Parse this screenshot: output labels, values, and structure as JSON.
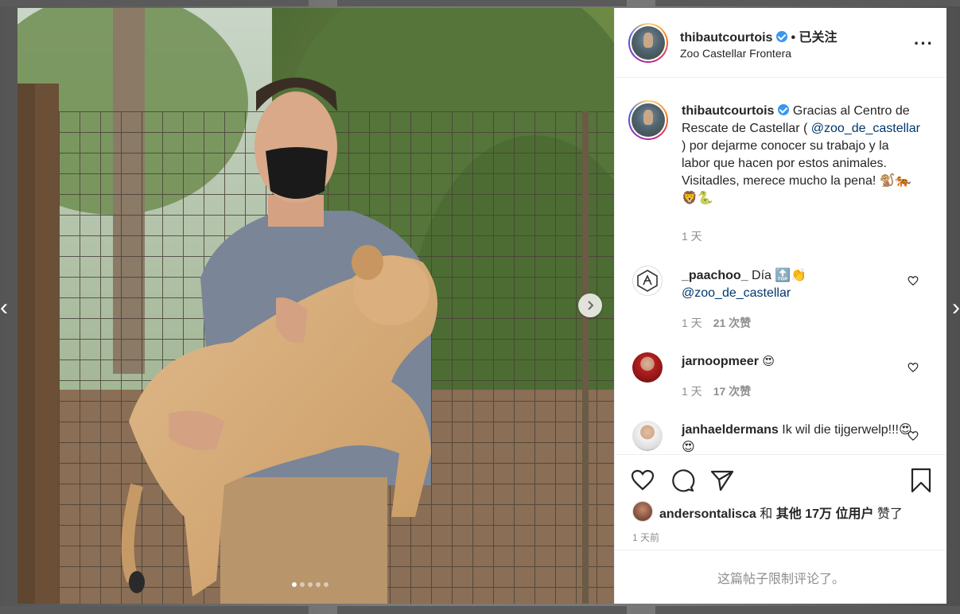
{
  "post": {
    "author": "thibautcourtois",
    "follow_state": "• 已关注",
    "location": "Zoo Castellar Frontera",
    "more_label": "···",
    "caption_parts": {
      "before": "Gracias al Centro de Rescate de Castellar (",
      "mention": "@zoo_de_castellar",
      "after": ") por dejarme conocer su trabajo y la labor que hacen por estos animales. Visitadles, merece mucho la pena! 🐒🐅🦁🐍"
    },
    "caption_time": "1 天"
  },
  "comments": [
    {
      "user": "_paachoo_",
      "text_before": "Día 🔝👏",
      "mention": "@zoo_de_castellar",
      "time": "1 天",
      "likes": "21 次赞"
    },
    {
      "user": "jarnoopmeer",
      "text": "😍",
      "time": "1 天",
      "likes": "17 次赞"
    },
    {
      "user": "janhaeldermans",
      "text": "Ik wil die tijgerwelp!!!😍😍"
    }
  ],
  "liked_by": {
    "user": "andersontalisca",
    "connector": "和",
    "others": "其他 17万 位用户",
    "suffix": "赞了"
  },
  "posted_time": "1 天前",
  "comments_disabled": "这篇帖子限制评论了。",
  "carousel": {
    "count": 5,
    "active": 0
  },
  "colors": {
    "verified": "#3897f0",
    "mention": "#00376b",
    "muted": "#8e8e8e"
  }
}
